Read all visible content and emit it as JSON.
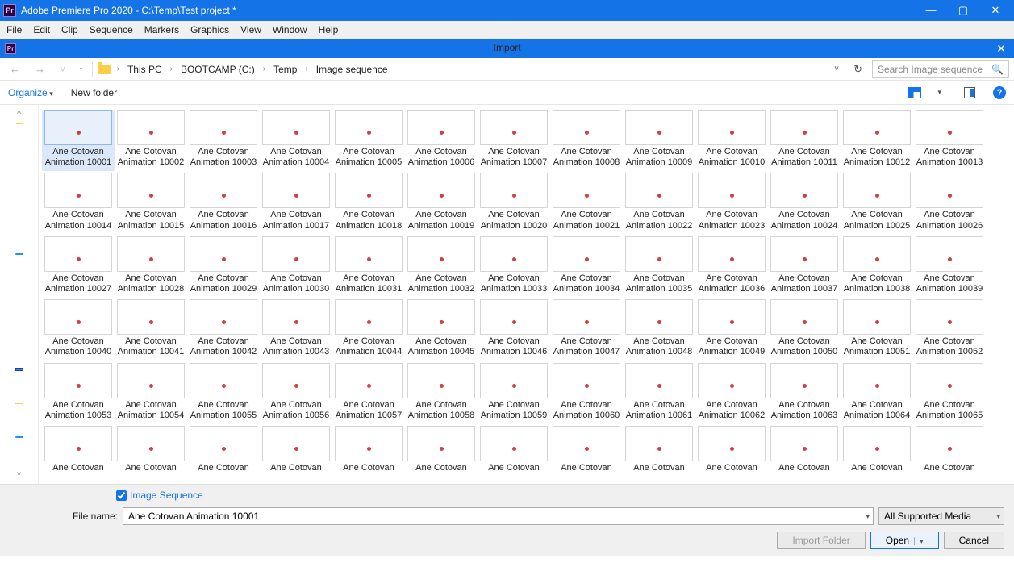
{
  "titlebar": {
    "title": "Adobe Premiere Pro 2020 - C:\\Temp\\Test project *",
    "icon": "Pr"
  },
  "menubar": [
    "File",
    "Edit",
    "Clip",
    "Sequence",
    "Markers",
    "Graphics",
    "View",
    "Window",
    "Help"
  ],
  "importbar": {
    "label": "Import",
    "icon": "Pr"
  },
  "breadcrumbs": [
    "This PC",
    "BOOTCAMP (C:)",
    "Temp",
    "Image sequence"
  ],
  "search_placeholder": "Search Image sequence",
  "toolbar": {
    "organize": "Organize",
    "newfolder": "New folder"
  },
  "file_label_prefix": "Ane Cotovan Animation ",
  "file_start": 10001,
  "file_count_rows": 6,
  "file_cols": 13,
  "thumb_texts": [
    "",
    "",
    "",
    "",
    "",
    "",
    "",
    "",
    "",
    "",
    "",
    "",
    "",
    "",
    "",
    "",
    "",
    "",
    "",
    "",
    "",
    "",
    "",
    "",
    "",
    "",
    "",
    "",
    "",
    "",
    "",
    "",
    "",
    "",
    "",
    "",
    "",
    "",
    "",
    "",
    "",
    "",
    "",
    "",
    "",
    "",
    "",
    "",
    "",
    "",
    "",
    "",
    "",
    "",
    "",
    "",
    "",
    "",
    "",
    "",
    "",
    "",
    "",
    "",
    "",
    "",
    "",
    "",
    "",
    "",
    "",
    "",
    "",
    "",
    "",
    "",
    "",
    ""
  ],
  "image_sequence_label": "Image Sequence",
  "filename_label": "File name:",
  "filename_value": "Ane Cotovan Animation 10001",
  "filter_value": "All Supported Media",
  "buttons": {
    "import_folder": "Import Folder",
    "open": "Open",
    "cancel": "Cancel"
  }
}
